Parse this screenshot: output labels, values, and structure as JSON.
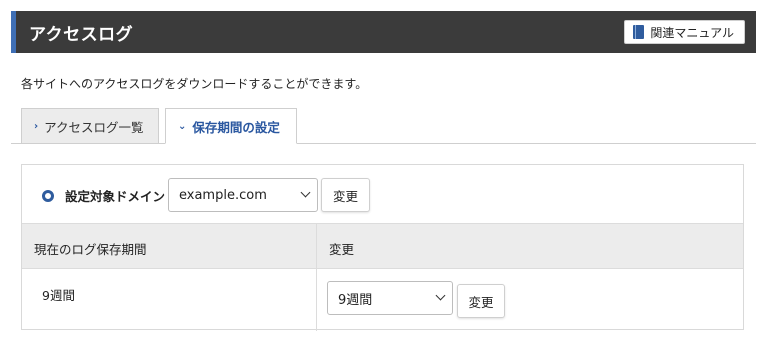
{
  "header": {
    "title": "アクセスログ",
    "manual_button": "関連マニュアル"
  },
  "description": "各サイトへのアクセスログをダウンロードすることができます。",
  "tabs": [
    {
      "label": "アクセスログ一覧",
      "active": false
    },
    {
      "label": "保存期間の設定",
      "active": true
    }
  ],
  "domain": {
    "label": "設定対象ドメイン",
    "selected": "example.com",
    "change_button": "変更"
  },
  "table": {
    "headers": [
      "現在のログ保存期間",
      "変更"
    ],
    "current_period": "9週間",
    "period_selected": "9週間",
    "change_button": "変更"
  },
  "colors": {
    "header_bg": "#3b3b3b",
    "accent": "#3f6fb5",
    "tab_active_text": "#2a57a0"
  }
}
